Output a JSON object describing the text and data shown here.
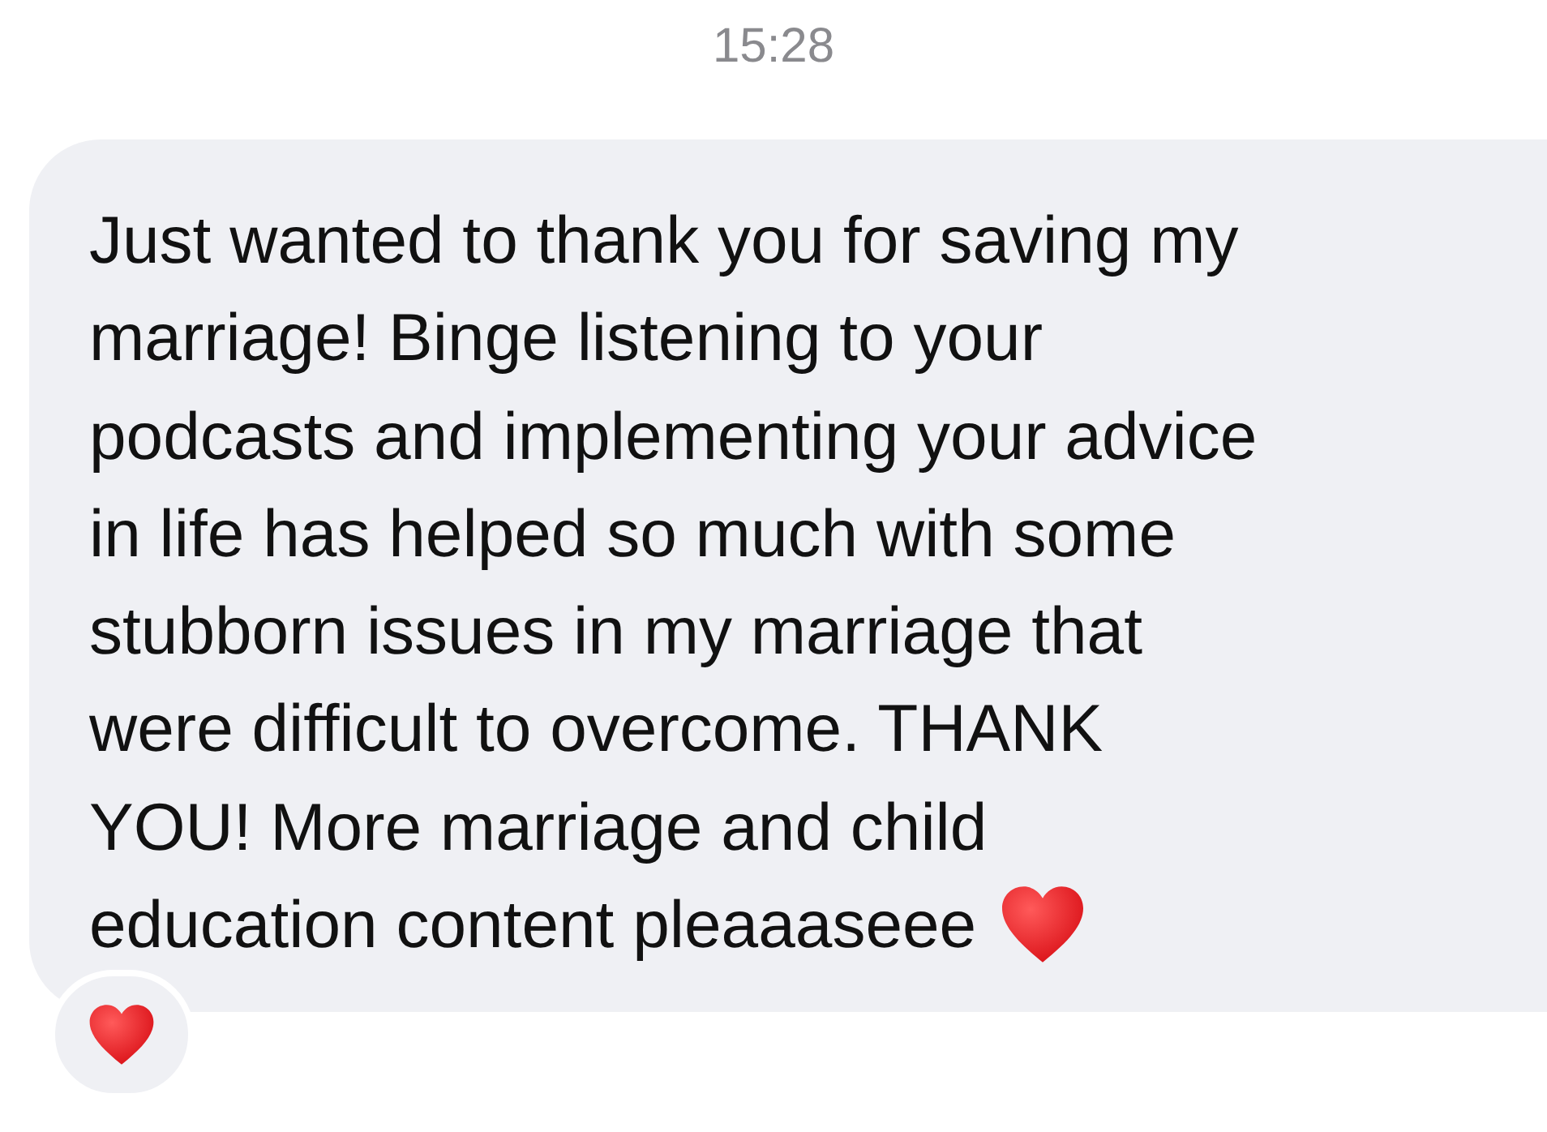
{
  "timestamp": "15:28",
  "message": {
    "lines": [
      "Just wanted to thank you for saving my",
      "marriage! Binge listening to your",
      "podcasts and implementing your advice",
      "in life has helped so much with some",
      "stubborn issues in my marriage that",
      "were difficult to overcome. THANK",
      "YOU! More marriage and child",
      "education content pleaaaseee"
    ],
    "trailing_emoji": {
      "kind": "heart"
    },
    "reaction": {
      "kind": "heart"
    }
  }
}
